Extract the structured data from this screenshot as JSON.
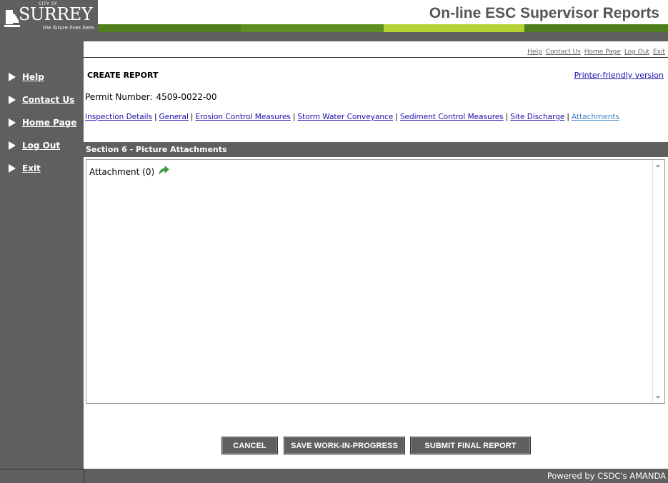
{
  "header": {
    "logo": {
      "city": "CITY OF",
      "word": "SURREY",
      "tagline": "the future lives here."
    },
    "app_title": "On-line ESC Supervisor Reports",
    "stripe_colors": [
      "#4e7d1c",
      "#5e8f21",
      "#7cae2a",
      "#b5d334",
      "#6f9f25"
    ]
  },
  "top_links": [
    "Help",
    "Contact Us",
    "Home Page",
    "Log Out",
    "Exit"
  ],
  "sidebar": {
    "items": [
      {
        "label": "Help"
      },
      {
        "label": "Contact Us"
      },
      {
        "label": "Home Page"
      },
      {
        "label": "Log Out"
      },
      {
        "label": "Exit"
      }
    ]
  },
  "main": {
    "title": "CREATE REPORT",
    "printer_link": "Printer-friendly version",
    "permit_label": "Permit Number:",
    "permit_number": "4509-0022-00",
    "section_nav": [
      "Inspection Details",
      "General",
      "Erosion Control Measures",
      "Storm Water Conveyance",
      "Sediment Control Measures",
      "Site Discharge",
      "Attachments"
    ],
    "section_title": "Section 6 - Picture Attachments",
    "attachment_label": "Attachment (0)",
    "attachment_icon": "green-arrow-icon"
  },
  "buttons": {
    "cancel": "CANCEL",
    "save": "SAVE WORK-IN-PROGRESS",
    "submit": "SUBMIT FINAL REPORT"
  },
  "footer": {
    "text": "Powered by CSDC's AMANDA"
  },
  "colors": {
    "chrome_gray": "#5f5f5f",
    "link_blue": "#1a0dab",
    "arrow_green": "#3aa435"
  }
}
